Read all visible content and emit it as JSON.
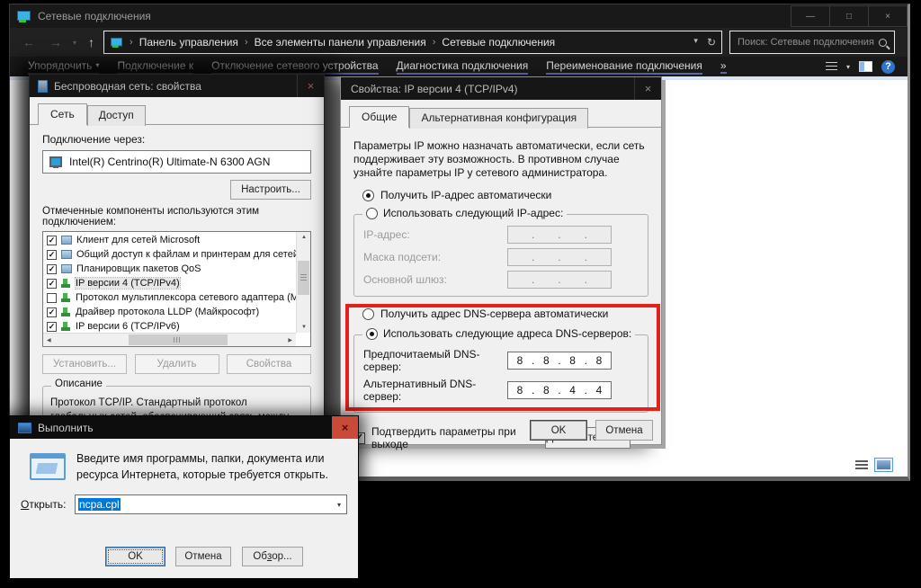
{
  "colors": {
    "highlight": "#e3201b",
    "selection": "#0078d7",
    "help": "#2f74c9",
    "underline": "#5a68a8"
  },
  "icons": {
    "back": "←",
    "forward": "→",
    "up": "↑",
    "chevron_down": "▾",
    "refresh": "↻",
    "minimize": "—",
    "maximize": "□",
    "close": "×",
    "help": "?",
    "overflow": "»",
    "crumb_sep": "›",
    "check": "✓",
    "dot": ".",
    "scroll_up": "▲",
    "scroll_down": "▼",
    "scroll_left": "◀",
    "scroll_right": "▶"
  },
  "window": {
    "title": "Сетевые подключения",
    "breadcrumb": [
      "Панель управления",
      "Все элементы панели управления",
      "Сетевые подключения"
    ],
    "search": "Поиск: Сетевые подключения",
    "toolbar": [
      "Упорядочить",
      "Подключение к",
      "Отключение сетевого устройства",
      "Диагностика подключения",
      "Переименование подключения"
    ]
  },
  "wireless": {
    "title": "Беспроводная сеть: свойства",
    "tabs": [
      "Сеть",
      "Доступ"
    ],
    "connection_label": "Подключение через:",
    "adapter": "Intel(R) Centrino(R) Ultimate-N 6300 AGN",
    "configure": "Настроить...",
    "components_label": "Отмеченные компоненты используются этим подключением:",
    "components": [
      {
        "mark": "✓",
        "label": "Клиент для сетей Microsoft"
      },
      {
        "mark": "✓",
        "label": "Общий доступ к файлам и принтерам для сетей Microsoft"
      },
      {
        "mark": "✓",
        "label": "Планировщик пакетов QoS"
      },
      {
        "mark": "✓",
        "label": "IP версии 4 (TCP/IPv4)"
      },
      {
        "mark": "",
        "label": "Протокол мультиплексора сетевого адаптера (Майкрософт)"
      },
      {
        "mark": "✓",
        "label": "Драйвер протокола LLDP (Майкрософт)"
      },
      {
        "mark": "✓",
        "label": "IP версии 6 (TCP/IPv6)"
      }
    ],
    "install": "Установить...",
    "uninstall": "Удалить",
    "properties": "Свойства",
    "description_title": "Описание",
    "description_text": "Протокол TCP/IP. Стандартный протокол глобальных сетей, обеспечивающий связь между различными взаимодействующими сетями."
  },
  "ipv4": {
    "title": "Свойства: IP версии 4 (TCP/IPv4)",
    "tabs": [
      "Общие",
      "Альтернативная конфигурация"
    ],
    "intro": "Параметры IP можно назначать автоматически, если сеть поддерживает эту возможность. В противном случае узнайте параметры IP у сетевого администратора.",
    "auto_ip": "Получить IP-адрес автоматически",
    "manual_ip": "Использовать следующий IP-адрес:",
    "ip_label": "IP-адрес:",
    "mask_label": "Маска подсети:",
    "gateway_label": "Основной шлюз:",
    "auto_dns": "Получить адрес DNS-сервера автоматически",
    "manual_dns": "Использовать следующие адреса DNS-серверов:",
    "preferred_label": "Предпочитаемый DNS-сервер:",
    "preferred": [
      "8",
      "8",
      "8",
      "8"
    ],
    "alternate_label": "Альтернативный DNS-сервер:",
    "alternate": [
      "8",
      "8",
      "4",
      "4"
    ],
    "confirm": "Подтвердить параметры при выходе",
    "advanced": "Дополнительно...",
    "ok": "OK",
    "cancel": "Отмена"
  },
  "run": {
    "title": "Выполнить",
    "message": "Введите имя программы, папки, документа или ресурса Интернета, которые требуется открыть.",
    "open_key": "О",
    "open_post": "ткрыть:",
    "value": "ncpa.cpl",
    "ok": "OK",
    "cancel": "Отмена",
    "browse_pre": "Об",
    "browse_key": "з",
    "browse_post": "ор..."
  }
}
